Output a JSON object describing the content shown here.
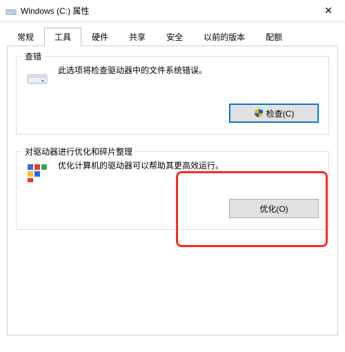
{
  "window": {
    "title": "Windows (C:) 属性",
    "close_glyph": "✕"
  },
  "tabs": {
    "items": [
      {
        "label": "常规"
      },
      {
        "label": "工具"
      },
      {
        "label": "硬件"
      },
      {
        "label": "共享"
      },
      {
        "label": "安全"
      },
      {
        "label": "以前的版本"
      },
      {
        "label": "配额"
      }
    ],
    "active_index": 1
  },
  "check_group": {
    "label": "查错",
    "text": "此选项将检查驱动器中的文件系统错误。",
    "button": "检查(C)"
  },
  "optimize_group": {
    "label": "对驱动器进行优化和碎片整理",
    "text": "优化计算机的驱动器可以帮助其更高效运行。",
    "button": "优化(O)"
  }
}
